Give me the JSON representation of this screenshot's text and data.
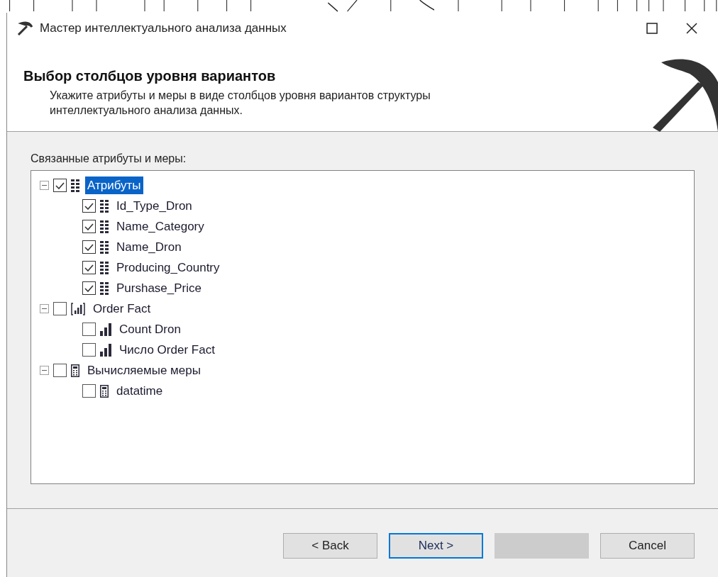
{
  "window": {
    "title": "Мастер интеллектуального анализа данных"
  },
  "header": {
    "title": "Выбор столбцов уровня вариантов",
    "description": "Укажите атрибуты и меры в виде столбцов уровня вариантов структуры интеллектуального анализа данных."
  },
  "tree_label": "Связанные атрибуты и меры:",
  "tree": [
    {
      "label": "Атрибуты",
      "kind": "attribute",
      "checked": true,
      "selected": true,
      "expanded": true,
      "children": [
        {
          "label": "Id_Type_Dron",
          "kind": "attribute",
          "checked": true,
          "selected": false
        },
        {
          "label": "Name_Category",
          "kind": "attribute",
          "checked": true,
          "selected": false
        },
        {
          "label": "Name_Dron",
          "kind": "attribute",
          "checked": true,
          "selected": false
        },
        {
          "label": "Producing_Country",
          "kind": "attribute",
          "checked": true,
          "selected": false
        },
        {
          "label": "Purshase_Price",
          "kind": "attribute",
          "checked": true,
          "selected": false
        }
      ]
    },
    {
      "label": "Order Fact",
      "kind": "measure-group",
      "checked": false,
      "selected": false,
      "expanded": true,
      "children": [
        {
          "label": "Count Dron",
          "kind": "measure",
          "checked": false,
          "selected": false
        },
        {
          "label": "Число Order Fact",
          "kind": "measure",
          "checked": false,
          "selected": false
        }
      ]
    },
    {
      "label": "Вычисляемые меры",
      "kind": "calculated",
      "checked": false,
      "selected": false,
      "expanded": true,
      "children": [
        {
          "label": "datatime",
          "kind": "calculated",
          "checked": false,
          "selected": false
        }
      ]
    }
  ],
  "buttons": [
    {
      "label": "< Back",
      "default": false,
      "disabled": false
    },
    {
      "label": "Next >",
      "default": true,
      "disabled": false
    },
    {
      "disabled": true
    },
    {
      "label": "Cancel",
      "default": false,
      "disabled": false
    }
  ]
}
